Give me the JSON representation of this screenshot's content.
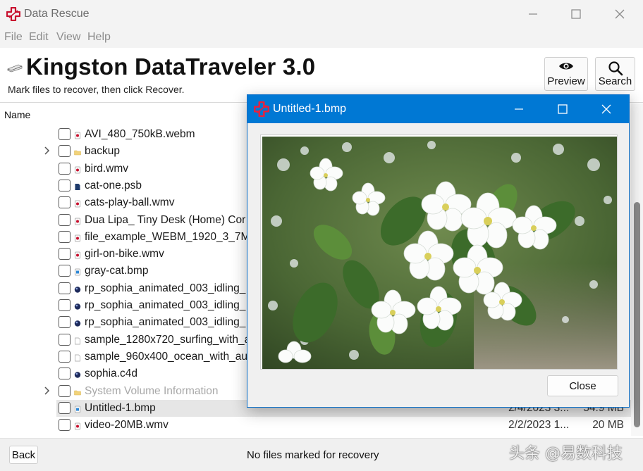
{
  "app": {
    "title": "Data Rescue",
    "accent_color": "#c8102e"
  },
  "menu": [
    "File",
    "Edit",
    "View",
    "Help"
  ],
  "header": {
    "drive_title": "Kingston DataTraveler 3.0",
    "subtitle": "Mark files to recover, then click Recover.",
    "preview_label": "Preview",
    "search_label": "Search"
  },
  "list": {
    "column_name": "Name",
    "rows": [
      {
        "name": "AVI_480_750kB.webm",
        "icon": "video-icon",
        "expandable": false,
        "disabled": false,
        "date": "",
        "size": ""
      },
      {
        "name": "backup",
        "icon": "folder-icon",
        "expandable": true,
        "disabled": false,
        "date": "",
        "size": ""
      },
      {
        "name": "bird.wmv",
        "icon": "video-icon",
        "expandable": false,
        "disabled": false,
        "date": "",
        "size": ""
      },
      {
        "name": "cat-one.psb",
        "icon": "document-icon",
        "expandable": false,
        "disabled": false,
        "date": "",
        "size": ""
      },
      {
        "name": "cats-play-ball.wmv",
        "icon": "video-icon",
        "expandable": false,
        "disabled": false,
        "date": "",
        "size": ""
      },
      {
        "name": "Dua Lipa_ Tiny Desk (Home) Cor",
        "icon": "video-icon",
        "expandable": false,
        "disabled": false,
        "date": "",
        "size": ""
      },
      {
        "name": "file_example_WEBM_1920_3_7M",
        "icon": "video-icon",
        "expandable": false,
        "disabled": false,
        "date": "",
        "size": ""
      },
      {
        "name": "girl-on-bike.wmv",
        "icon": "video-icon",
        "expandable": false,
        "disabled": false,
        "date": "",
        "size": ""
      },
      {
        "name": "gray-cat.bmp",
        "icon": "image-icon",
        "expandable": false,
        "disabled": false,
        "date": "",
        "size": ""
      },
      {
        "name": "rp_sophia_animated_003_idling_",
        "icon": "model-icon",
        "expandable": false,
        "disabled": false,
        "date": "",
        "size": ""
      },
      {
        "name": "rp_sophia_animated_003_idling_",
        "icon": "model-icon",
        "expandable": false,
        "disabled": false,
        "date": "",
        "size": ""
      },
      {
        "name": "rp_sophia_animated_003_idling_",
        "icon": "model-icon",
        "expandable": false,
        "disabled": false,
        "date": "",
        "size": ""
      },
      {
        "name": "sample_1280x720_surfing_with_a",
        "icon": "blank-file-icon",
        "expandable": false,
        "disabled": false,
        "date": "",
        "size": ""
      },
      {
        "name": "sample_960x400_ocean_with_au",
        "icon": "blank-file-icon",
        "expandable": false,
        "disabled": false,
        "date": "",
        "size": ""
      },
      {
        "name": "sophia.c4d",
        "icon": "model-icon",
        "expandable": false,
        "disabled": false,
        "date": "",
        "size": ""
      },
      {
        "name": "System Volume Information",
        "icon": "folder-icon",
        "expandable": true,
        "disabled": true,
        "date": "",
        "size": ""
      },
      {
        "name": "Untitled-1.bmp",
        "icon": "image-icon",
        "expandable": false,
        "disabled": false,
        "date": "2/4/2023 3...",
        "size": "54.9 MB",
        "selected": true
      },
      {
        "name": "video-20MB.wmv",
        "icon": "video-icon",
        "expandable": false,
        "disabled": false,
        "date": "2/2/2023 1...",
        "size": "20 MB"
      }
    ]
  },
  "footer": {
    "back_label": "Back",
    "status": "No files marked for recovery",
    "watermark": "头条 @易数科技"
  },
  "dialog": {
    "title": "Untitled-1.bmp",
    "close_label": "Close",
    "titlebar_color": "#0078d4"
  }
}
